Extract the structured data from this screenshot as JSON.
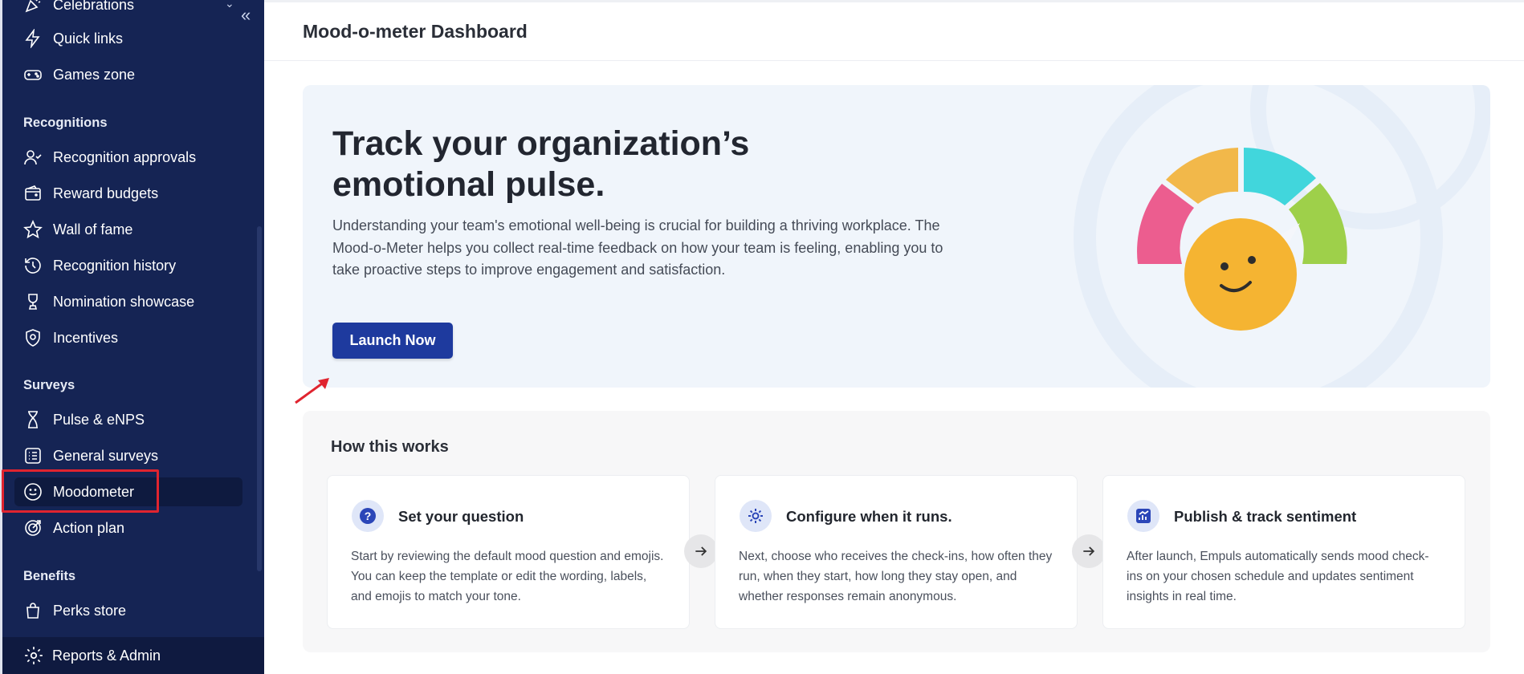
{
  "sidebar": {
    "items_top": [
      {
        "label": "Celebrations",
        "icon": "party-popper-icon"
      },
      {
        "label": "Quick links",
        "icon": "lightning-icon"
      },
      {
        "label": "Games zone",
        "icon": "gamepad-icon"
      }
    ],
    "sections": [
      {
        "title": "Recognitions",
        "items": [
          {
            "label": "Recognition approvals",
            "icon": "user-check-icon"
          },
          {
            "label": "Reward budgets",
            "icon": "wallet-icon"
          },
          {
            "label": "Wall of fame",
            "icon": "star-icon"
          },
          {
            "label": "Recognition history",
            "icon": "history-icon"
          },
          {
            "label": "Nomination showcase",
            "icon": "trophy-icon"
          },
          {
            "label": "Incentives",
            "icon": "badge-icon"
          }
        ]
      },
      {
        "title": "Surveys",
        "items": [
          {
            "label": "Pulse & eNPS",
            "icon": "hourglass-icon"
          },
          {
            "label": "General surveys",
            "icon": "list-icon"
          },
          {
            "label": "Moodometer",
            "icon": "smiley-icon",
            "active": true
          },
          {
            "label": "Action plan",
            "icon": "target-icon"
          }
        ]
      },
      {
        "title": "Benefits",
        "items": [
          {
            "label": "Perks store",
            "icon": "shopping-bag-icon"
          }
        ]
      }
    ],
    "footer": {
      "label": "Reports & Admin",
      "icon": "gear-icon"
    },
    "collapse_icon": "double-chevron-left-icon"
  },
  "main": {
    "title": "Mood-o-meter Dashboard",
    "hero": {
      "heading": "Track your organization’s emotional pulse.",
      "description": "Understanding your team's emotional well-being is crucial for building a thriving workplace. The Mood-o-Meter helps you collect real-time feedback on how your team is feeling, enabling you to take proactive steps to improve engagement and satisfaction.",
      "button_label": "Launch Now",
      "illustration": "mood-meter-illustration"
    },
    "how": {
      "title": "How this works",
      "steps": [
        {
          "title": "Set your question",
          "icon": "question-icon",
          "description": " Start by reviewing the default mood question and emojis. You can keep the template or edit the wording, labels, and emojis to match your tone."
        },
        {
          "title": "Configure when it runs.",
          "icon": "gear-icon",
          "description": " Next, choose who receives the check-ins, how often they run, when they start, how long they stay open, and whether responses remain anonymous."
        },
        {
          "title": "Publish & track sentiment",
          "icon": "chart-icon",
          "description": " After launch, Empuls automatically sends mood check-ins on your chosen schedule and updates sentiment insights in real time."
        }
      ]
    }
  },
  "colors": {
    "sidebar_bg": "#152454",
    "accent": "#1e3a9e",
    "annotation": "#e0242f",
    "hero_bg": "#f0f5fb"
  }
}
